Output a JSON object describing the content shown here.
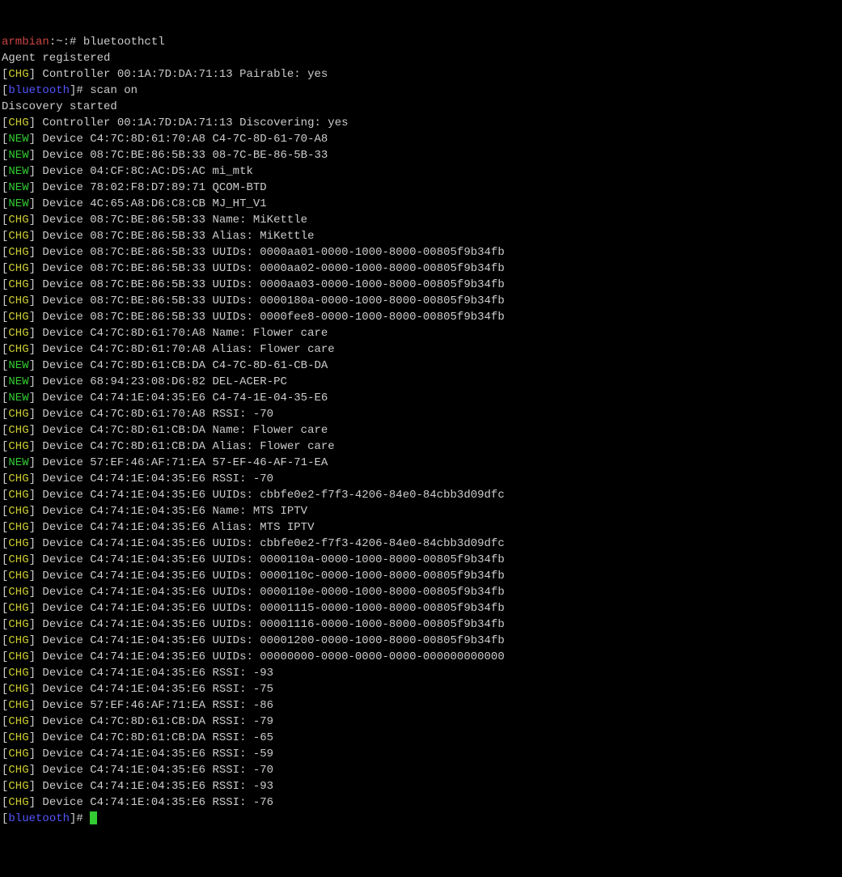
{
  "line1": {
    "host": "armbian",
    "path": ":~:#",
    "cmd": " bluetoothctl"
  },
  "line2": "Agent registered",
  "line3": {
    "br1": "[",
    "tag": "CHG",
    "br2": "]",
    "rest": " Controller 00:1A:7D:DA:71:13 Pairable: yes"
  },
  "line4": {
    "br1": "[",
    "prompt": "bluetooth",
    "br2": "]#",
    "cmd": " scan on"
  },
  "line5": "Discovery started",
  "events": [
    {
      "tag": "CHG",
      "text": " Controller 00:1A:7D:DA:71:13 Discovering: yes"
    },
    {
      "tag": "NEW",
      "text": " Device C4:7C:8D:61:70:A8 C4-7C-8D-61-70-A8"
    },
    {
      "tag": "NEW",
      "text": " Device 08:7C:BE:86:5B:33 08-7C-BE-86-5B-33"
    },
    {
      "tag": "NEW",
      "text": " Device 04:CF:8C:AC:D5:AC mi_mtk"
    },
    {
      "tag": "NEW",
      "text": " Device 78:02:F8:D7:89:71 QCOM-BTD"
    },
    {
      "tag": "NEW",
      "text": " Device 4C:65:A8:D6:C8:CB MJ_HT_V1"
    },
    {
      "tag": "CHG",
      "text": " Device 08:7C:BE:86:5B:33 Name: MiKettle"
    },
    {
      "tag": "CHG",
      "text": " Device 08:7C:BE:86:5B:33 Alias: MiKettle"
    },
    {
      "tag": "CHG",
      "text": " Device 08:7C:BE:86:5B:33 UUIDs: 0000aa01-0000-1000-8000-00805f9b34fb"
    },
    {
      "tag": "CHG",
      "text": " Device 08:7C:BE:86:5B:33 UUIDs: 0000aa02-0000-1000-8000-00805f9b34fb"
    },
    {
      "tag": "CHG",
      "text": " Device 08:7C:BE:86:5B:33 UUIDs: 0000aa03-0000-1000-8000-00805f9b34fb"
    },
    {
      "tag": "CHG",
      "text": " Device 08:7C:BE:86:5B:33 UUIDs: 0000180a-0000-1000-8000-00805f9b34fb"
    },
    {
      "tag": "CHG",
      "text": " Device 08:7C:BE:86:5B:33 UUIDs: 0000fee8-0000-1000-8000-00805f9b34fb"
    },
    {
      "tag": "CHG",
      "text": " Device C4:7C:8D:61:70:A8 Name: Flower care"
    },
    {
      "tag": "CHG",
      "text": " Device C4:7C:8D:61:70:A8 Alias: Flower care"
    },
    {
      "tag": "NEW",
      "text": " Device C4:7C:8D:61:CB:DA C4-7C-8D-61-CB-DA"
    },
    {
      "tag": "NEW",
      "text": " Device 68:94:23:08:D6:82 DEL-ACER-PC"
    },
    {
      "tag": "NEW",
      "text": " Device C4:74:1E:04:35:E6 C4-74-1E-04-35-E6"
    },
    {
      "tag": "CHG",
      "text": " Device C4:7C:8D:61:70:A8 RSSI: -70"
    },
    {
      "tag": "CHG",
      "text": " Device C4:7C:8D:61:CB:DA Name: Flower care"
    },
    {
      "tag": "CHG",
      "text": " Device C4:7C:8D:61:CB:DA Alias: Flower care"
    },
    {
      "tag": "NEW",
      "text": " Device 57:EF:46:AF:71:EA 57-EF-46-AF-71-EA"
    },
    {
      "tag": "CHG",
      "text": " Device C4:74:1E:04:35:E6 RSSI: -70"
    },
    {
      "tag": "CHG",
      "text": " Device C4:74:1E:04:35:E6 UUIDs: cbbfe0e2-f7f3-4206-84e0-84cbb3d09dfc"
    },
    {
      "tag": "CHG",
      "text": " Device C4:74:1E:04:35:E6 Name: MTS IPTV"
    },
    {
      "tag": "CHG",
      "text": " Device C4:74:1E:04:35:E6 Alias: MTS IPTV"
    },
    {
      "tag": "CHG",
      "text": " Device C4:74:1E:04:35:E6 UUIDs: cbbfe0e2-f7f3-4206-84e0-84cbb3d09dfc"
    },
    {
      "tag": "CHG",
      "text": " Device C4:74:1E:04:35:E6 UUIDs: 0000110a-0000-1000-8000-00805f9b34fb"
    },
    {
      "tag": "CHG",
      "text": " Device C4:74:1E:04:35:E6 UUIDs: 0000110c-0000-1000-8000-00805f9b34fb"
    },
    {
      "tag": "CHG",
      "text": " Device C4:74:1E:04:35:E6 UUIDs: 0000110e-0000-1000-8000-00805f9b34fb"
    },
    {
      "tag": "CHG",
      "text": " Device C4:74:1E:04:35:E6 UUIDs: 00001115-0000-1000-8000-00805f9b34fb"
    },
    {
      "tag": "CHG",
      "text": " Device C4:74:1E:04:35:E6 UUIDs: 00001116-0000-1000-8000-00805f9b34fb"
    },
    {
      "tag": "CHG",
      "text": " Device C4:74:1E:04:35:E6 UUIDs: 00001200-0000-1000-8000-00805f9b34fb"
    },
    {
      "tag": "CHG",
      "text": " Device C4:74:1E:04:35:E6 UUIDs: 00000000-0000-0000-0000-000000000000"
    },
    {
      "tag": "CHG",
      "text": " Device C4:74:1E:04:35:E6 RSSI: -93"
    },
    {
      "tag": "CHG",
      "text": " Device C4:74:1E:04:35:E6 RSSI: -75"
    },
    {
      "tag": "CHG",
      "text": " Device 57:EF:46:AF:71:EA RSSI: -86"
    },
    {
      "tag": "CHG",
      "text": " Device C4:7C:8D:61:CB:DA RSSI: -79"
    },
    {
      "tag": "CHG",
      "text": " Device C4:7C:8D:61:CB:DA RSSI: -65"
    },
    {
      "tag": "CHG",
      "text": " Device C4:74:1E:04:35:E6 RSSI: -59"
    },
    {
      "tag": "CHG",
      "text": " Device C4:74:1E:04:35:E6 RSSI: -70"
    },
    {
      "tag": "CHG",
      "text": " Device C4:74:1E:04:35:E6 RSSI: -93"
    },
    {
      "tag": "CHG",
      "text": " Device C4:74:1E:04:35:E6 RSSI: -76"
    }
  ],
  "prompt_end": {
    "br1": "[",
    "prompt": "bluetooth",
    "br2": "]#",
    "sp": " "
  }
}
